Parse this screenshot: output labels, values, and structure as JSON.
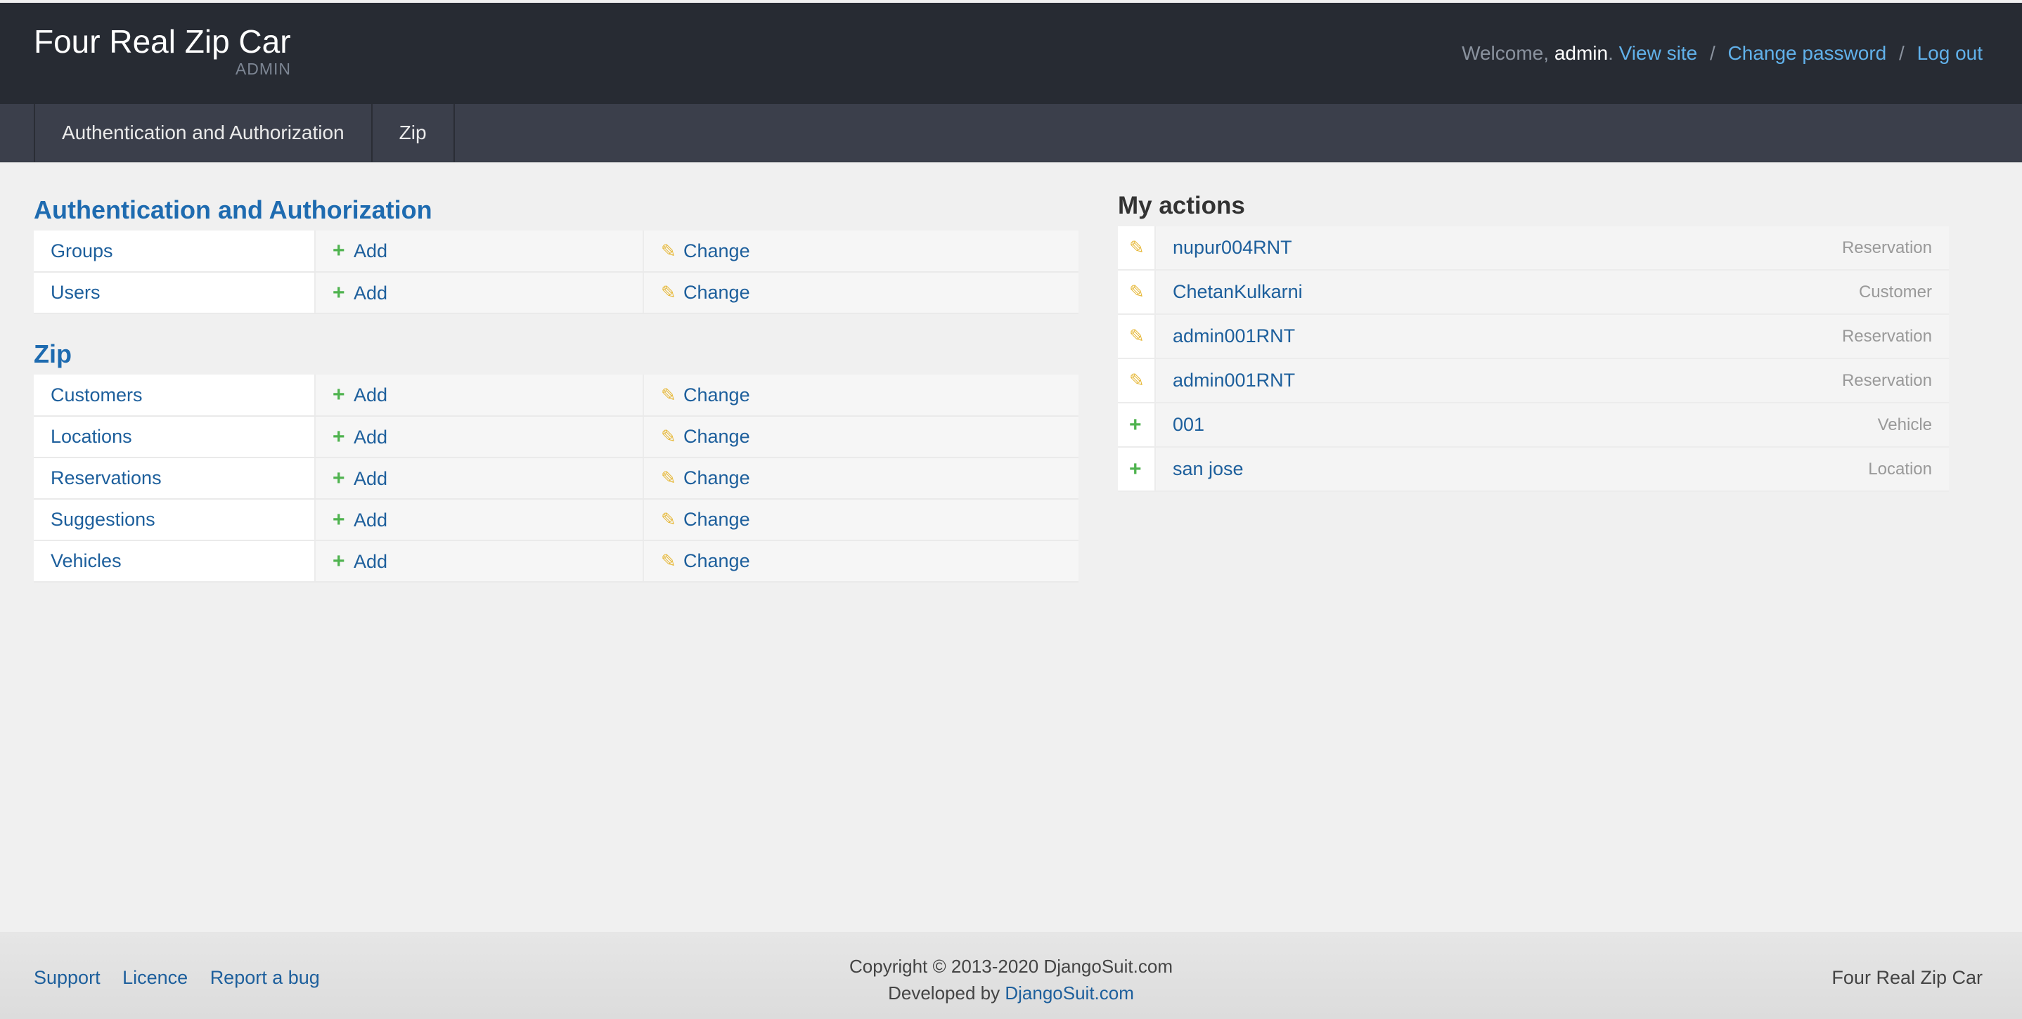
{
  "header": {
    "site_title": "Four Real Zip Car",
    "subtitle": "ADMIN",
    "welcome": "Welcome,",
    "username": "admin",
    "username_suffix": ".",
    "view_site": "View site",
    "change_password": "Change password",
    "logout": "Log out",
    "separator": "/"
  },
  "menu": {
    "items": [
      "Authentication and Authorization",
      "Zip"
    ]
  },
  "modules": [
    {
      "title": "Authentication and Authorization",
      "models": [
        {
          "name": "Groups",
          "add": "Add",
          "change": "Change"
        },
        {
          "name": "Users",
          "add": "Add",
          "change": "Change"
        }
      ]
    },
    {
      "title": "Zip",
      "models": [
        {
          "name": "Customers",
          "add": "Add",
          "change": "Change"
        },
        {
          "name": "Locations",
          "add": "Add",
          "change": "Change"
        },
        {
          "name": "Reservations",
          "add": "Add",
          "change": "Change"
        },
        {
          "name": "Suggestions",
          "add": "Add",
          "change": "Change"
        },
        {
          "name": "Vehicles",
          "add": "Add",
          "change": "Change"
        }
      ]
    }
  ],
  "actions": {
    "title": "My actions",
    "items": [
      {
        "icon": "pencil-icon",
        "label": "nupur004RNT",
        "type": "Reservation"
      },
      {
        "icon": "pencil-icon",
        "label": "ChetanKulkarni",
        "type": "Customer"
      },
      {
        "icon": "pencil-icon",
        "label": "admin001RNT",
        "type": "Reservation"
      },
      {
        "icon": "pencil-icon",
        "label": "admin001RNT",
        "type": "Reservation"
      },
      {
        "icon": "plus-icon",
        "label": "001",
        "type": "Vehicle"
      },
      {
        "icon": "plus-icon",
        "label": "san jose",
        "type": "Location"
      }
    ]
  },
  "footer": {
    "links": [
      "Support",
      "Licence",
      "Report a bug"
    ],
    "copyright": "Copyright © 2013-2020 DjangoSuit.com",
    "developed_by": "Developed by",
    "developer_link": "DjangoSuit.com",
    "right_text": "Four Real Zip Car"
  },
  "colors": {
    "header_bg": "#272b33",
    "menu_bg": "#3b3f4b",
    "link": "#1d5f9c",
    "header_link": "#61b1ea",
    "add_icon": "#4fb34f",
    "change_icon": "#e7b93b"
  }
}
